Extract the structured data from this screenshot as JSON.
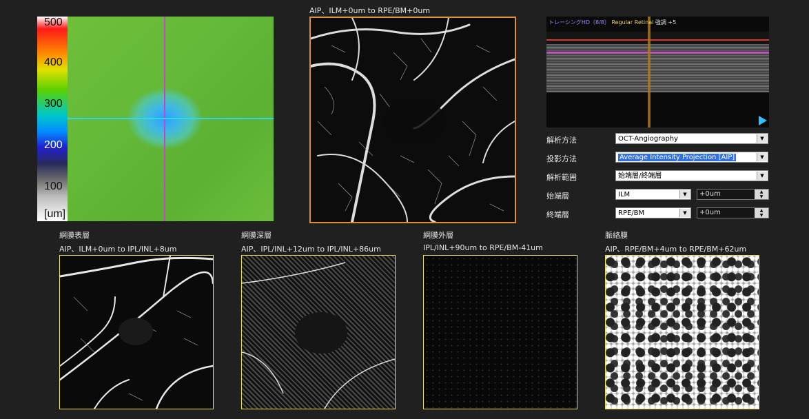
{
  "thickness_map": {
    "scale_ticks": [
      "500",
      "400",
      "300",
      "200",
      "100",
      "[um]"
    ]
  },
  "main_angio": {
    "title": "AIP、ILM+0um to RPE/BM+0um"
  },
  "bscan": {
    "header_blue": "トレーシングHD（8/8）",
    "header_yellow": "Regular Retinal",
    "header_white": "強調 +5"
  },
  "controls": {
    "analysis_method": {
      "label": "解析方法",
      "value": "OCT-Angiography"
    },
    "projection_method": {
      "label": "投影方法",
      "value": "Average Intensity Projection [AIP]"
    },
    "analysis_range": {
      "label": "解析範囲",
      "value": "始端層/終端層"
    },
    "start_layer": {
      "label": "始端層",
      "value": "ILM",
      "offset": "+0um"
    },
    "end_layer": {
      "label": "終端層",
      "value": "RPE/BM",
      "offset": "+0um"
    }
  },
  "slabs": [
    {
      "name": "網膜表層",
      "range": "AIP、ILM+0um to IPL/INL+8um"
    },
    {
      "name": "網膜深層",
      "range": "AIP、IPL/INL+12um to IPL/INL+86um"
    },
    {
      "name": "網膜外層",
      "range": "IPL/INL+90um to RPE/BM-41um"
    },
    {
      "name": "脈絡膜",
      "range": "AIP、RPE/BM+4um to RPE/BM+62um"
    }
  ],
  "colors": {
    "orange_frame": "#e09030",
    "yellow_frame": "#e8e060",
    "accent_blue": "#3070e0"
  }
}
